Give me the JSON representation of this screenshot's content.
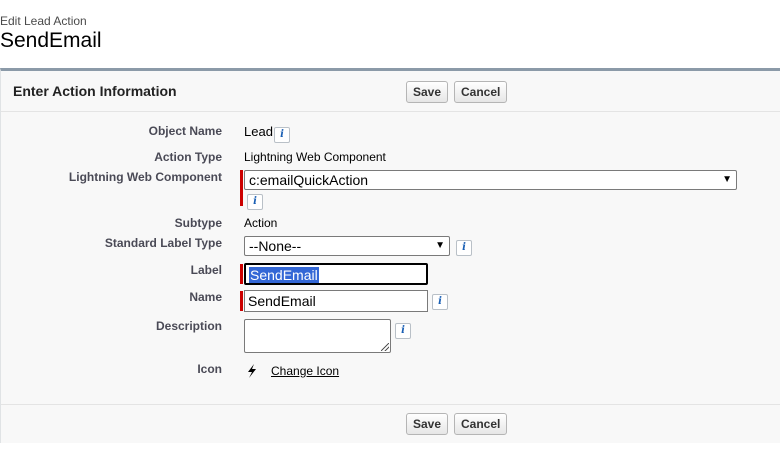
{
  "page": {
    "subtitle": "Edit Lead Action",
    "title": "SendEmail"
  },
  "panel": {
    "title": "Enter Action Information",
    "save_label": "Save",
    "cancel_label": "Cancel"
  },
  "fields": {
    "object_name": {
      "label": "Object Name",
      "value": "Lead"
    },
    "action_type": {
      "label": "Action Type",
      "value": "Lightning Web Component"
    },
    "lwc": {
      "label": "Lightning Web Component",
      "value": "c:emailQuickAction"
    },
    "subtype": {
      "label": "Subtype",
      "value": "Action"
    },
    "standard_label_type": {
      "label": "Standard Label Type",
      "value": "--None--"
    },
    "label": {
      "label": "Label",
      "value": "SendEmail"
    },
    "name": {
      "label": "Name",
      "value": "SendEmail"
    },
    "description": {
      "label": "Description",
      "value": ""
    },
    "icon": {
      "label": "Icon",
      "link": "Change Icon",
      "icon_name": "lightning-bolt-icon"
    }
  },
  "info_glyph": "i",
  "chevron_glyph": "⌄",
  "colors": {
    "required": "#cc0000",
    "selection": "#3367d6",
    "panel_border": "#8b9aa8"
  }
}
